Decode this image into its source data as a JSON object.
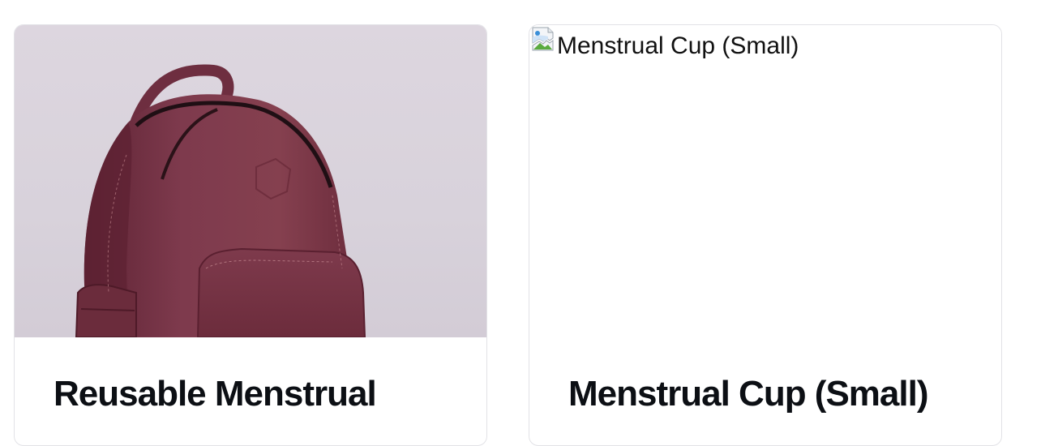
{
  "products": [
    {
      "title": "Reusable Menstrual",
      "image_alt": "Reusable Menstrual",
      "image_state": "loaded",
      "image_subject": "burgundy leather backpack",
      "colors": {
        "bag": "#7b3448",
        "background": "#dcd5de"
      }
    },
    {
      "title": "Menstrual Cup (Small)",
      "image_alt": "Menstrual Cup (Small)",
      "image_state": "broken",
      "image_icon": "broken-image-icon"
    }
  ]
}
